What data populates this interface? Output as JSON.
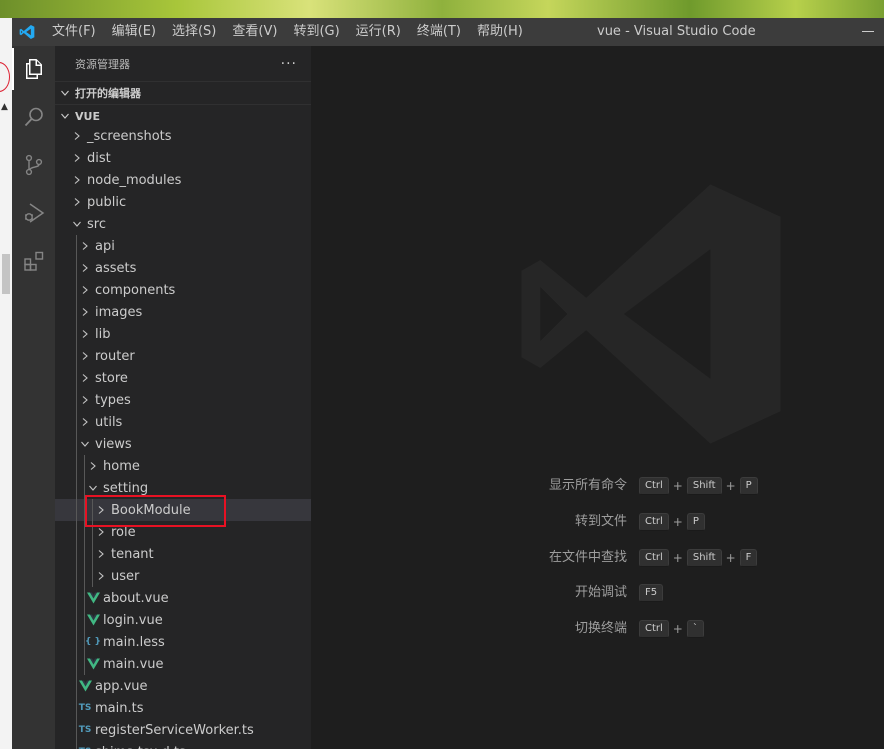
{
  "window": {
    "title": "vue - Visual Studio Code"
  },
  "menu": [
    "文件(F)",
    "编辑(E)",
    "选择(S)",
    "查看(V)",
    "转到(G)",
    "运行(R)",
    "终端(T)",
    "帮助(H)"
  ],
  "activity_bar": [
    {
      "icon": "files-icon",
      "active": true
    },
    {
      "icon": "search-icon",
      "active": false
    },
    {
      "icon": "source-control-icon",
      "active": false
    },
    {
      "icon": "run-debug-icon",
      "active": false
    },
    {
      "icon": "extensions-icon",
      "active": false
    }
  ],
  "sidebar": {
    "title": "资源管理器",
    "more": "···",
    "open_editors": "打开的编辑器",
    "workspace": "VUE",
    "tree": [
      {
        "label": "_screenshots",
        "kind": "folder",
        "depth": 0,
        "expanded": false
      },
      {
        "label": "dist",
        "kind": "folder",
        "depth": 0,
        "expanded": false
      },
      {
        "label": "node_modules",
        "kind": "folder",
        "depth": 0,
        "expanded": false
      },
      {
        "label": "public",
        "kind": "folder",
        "depth": 0,
        "expanded": false
      },
      {
        "label": "src",
        "kind": "folder",
        "depth": 0,
        "expanded": true
      },
      {
        "label": "api",
        "kind": "folder",
        "depth": 1,
        "expanded": false
      },
      {
        "label": "assets",
        "kind": "folder",
        "depth": 1,
        "expanded": false
      },
      {
        "label": "components",
        "kind": "folder",
        "depth": 1,
        "expanded": false
      },
      {
        "label": "images",
        "kind": "folder",
        "depth": 1,
        "expanded": false
      },
      {
        "label": "lib",
        "kind": "folder",
        "depth": 1,
        "expanded": false
      },
      {
        "label": "router",
        "kind": "folder",
        "depth": 1,
        "expanded": false
      },
      {
        "label": "store",
        "kind": "folder",
        "depth": 1,
        "expanded": false
      },
      {
        "label": "types",
        "kind": "folder",
        "depth": 1,
        "expanded": false
      },
      {
        "label": "utils",
        "kind": "folder",
        "depth": 1,
        "expanded": false
      },
      {
        "label": "views",
        "kind": "folder",
        "depth": 1,
        "expanded": true
      },
      {
        "label": "home",
        "kind": "folder",
        "depth": 2,
        "expanded": false
      },
      {
        "label": "setting",
        "kind": "folder",
        "depth": 2,
        "expanded": true
      },
      {
        "label": "BookModule",
        "kind": "folder",
        "depth": 3,
        "expanded": false,
        "selected": true
      },
      {
        "label": "role",
        "kind": "folder",
        "depth": 3,
        "expanded": false
      },
      {
        "label": "tenant",
        "kind": "folder",
        "depth": 3,
        "expanded": false
      },
      {
        "label": "user",
        "kind": "folder",
        "depth": 3,
        "expanded": false
      },
      {
        "label": "about.vue",
        "kind": "vue",
        "depth": 2
      },
      {
        "label": "login.vue",
        "kind": "vue",
        "depth": 2
      },
      {
        "label": "main.less",
        "kind": "less",
        "depth": 2
      },
      {
        "label": "main.vue",
        "kind": "vue",
        "depth": 2
      },
      {
        "label": "app.vue",
        "kind": "vue",
        "depth": 1
      },
      {
        "label": "main.ts",
        "kind": "ts",
        "depth": 1
      },
      {
        "label": "registerServiceWorker.ts",
        "kind": "ts",
        "depth": 1
      },
      {
        "label": "shims-tsx.d.ts",
        "kind": "ts",
        "depth": 1
      }
    ]
  },
  "file_icons": {
    "vue": "V",
    "ts": "TS",
    "less": "{ }"
  },
  "colors": {
    "vue": "#41b883",
    "ts": "#519aba",
    "less": "#519aba",
    "highlight": "#e81123",
    "accent": "#007acc"
  },
  "editor": {
    "shortcuts": [
      {
        "label": "显示所有命令",
        "keys": [
          "Ctrl",
          "Shift",
          "P"
        ]
      },
      {
        "label": "转到文件",
        "keys": [
          "Ctrl",
          "P"
        ]
      },
      {
        "label": "在文件中查找",
        "keys": [
          "Ctrl",
          "Shift",
          "F"
        ]
      },
      {
        "label": "开始调试",
        "keys": [
          "F5"
        ]
      },
      {
        "label": "切换终端",
        "keys": [
          "Ctrl",
          "`"
        ]
      }
    ]
  }
}
